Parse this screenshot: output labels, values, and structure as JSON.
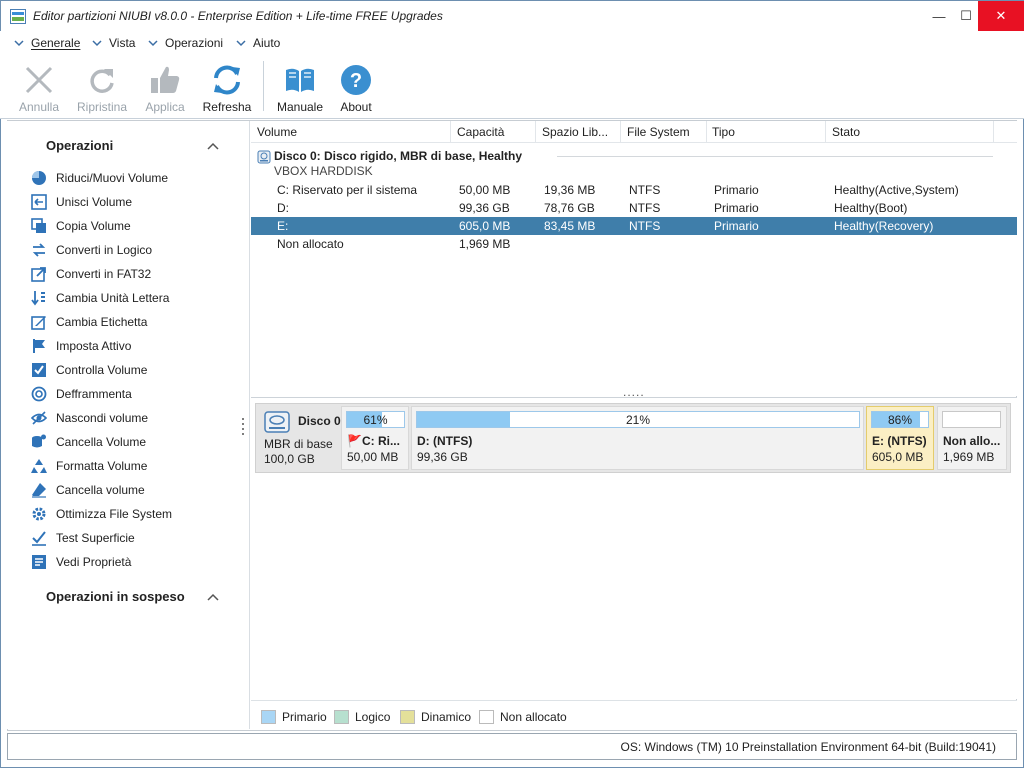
{
  "window": {
    "title": "Editor partizioni NIUBI v8.0.0 - Enterprise Edition + Life-time FREE Upgrades",
    "minimize_glyph": "—",
    "maximize_glyph": "☐",
    "close_glyph": "✕"
  },
  "menu": {
    "items": [
      {
        "label": "Generale"
      },
      {
        "label": "Vista"
      },
      {
        "label": "Operazioni"
      },
      {
        "label": "Aiuto"
      }
    ]
  },
  "toolbar": {
    "buttons": [
      {
        "label": "Annulla",
        "icon": "close-icon",
        "enabled": false
      },
      {
        "label": "Ripristina",
        "icon": "redo-icon",
        "enabled": false
      },
      {
        "label": "Applica",
        "icon": "thumbs-up-icon",
        "enabled": false
      },
      {
        "label": "Refresha",
        "icon": "refresh-icon",
        "enabled": true
      },
      {
        "label": "Manuale",
        "icon": "book-icon",
        "enabled": true
      },
      {
        "label": "About",
        "icon": "help-icon",
        "enabled": true
      }
    ]
  },
  "sidebar": {
    "operations_title": "Operazioni",
    "pending_title": "Operazioni in sospeso",
    "items": [
      {
        "label": "Riduci/Muovi Volume",
        "icon": "resize-icon"
      },
      {
        "label": "Unisci Volume",
        "icon": "merge-icon"
      },
      {
        "label": "Copia Volume",
        "icon": "copy-icon"
      },
      {
        "label": "Converti in Logico",
        "icon": "convert-icon"
      },
      {
        "label": "Converti in FAT32",
        "icon": "convert-fat32-icon"
      },
      {
        "label": "Cambia Unità Lettera",
        "icon": "drive-letter-icon"
      },
      {
        "label": "Cambia Etichetta",
        "icon": "edit-label-icon"
      },
      {
        "label": "Imposta Attivo",
        "icon": "flag-icon"
      },
      {
        "label": "Controlla Volume",
        "icon": "check-icon"
      },
      {
        "label": "Defframmenta",
        "icon": "defrag-icon"
      },
      {
        "label": "Nascondi volume",
        "icon": "hide-icon"
      },
      {
        "label": "Cancella Volume",
        "icon": "delete-volume-icon"
      },
      {
        "label": "Formatta Volume",
        "icon": "format-icon"
      },
      {
        "label": "Cancella volume",
        "icon": "eraser-icon"
      },
      {
        "label": "Ottimizza File System",
        "icon": "optimize-icon"
      },
      {
        "label": "Test Superficie",
        "icon": "surface-test-icon"
      },
      {
        "label": "Vedi Proprietà",
        "icon": "properties-icon"
      }
    ]
  },
  "table": {
    "columns": [
      "Volume",
      "Capacità",
      "Spazio Lib...",
      "File System",
      "Tipo",
      "Stato"
    ],
    "disk": {
      "title": "Disco 0: Disco rigido, MBR di base, Healthy",
      "subtitle": "VBOX HARDDISK"
    },
    "rows": [
      {
        "volume": "C: Riservato per il sistema",
        "capacity": "50,00 MB",
        "free": "19,36 MB",
        "fs": "NTFS",
        "type": "Primario",
        "status": "Healthy(Active,System)",
        "selected": false
      },
      {
        "volume": "D:",
        "capacity": "99,36 GB",
        "free": "78,76 GB",
        "fs": "NTFS",
        "type": "Primario",
        "status": "Healthy(Boot)",
        "selected": false
      },
      {
        "volume": "E:",
        "capacity": "605,0 MB",
        "free": "83,45 MB",
        "fs": "NTFS",
        "type": "Primario",
        "status": "Healthy(Recovery)",
        "selected": true
      },
      {
        "volume": "Non allocato",
        "capacity": "1,969 MB",
        "free": "",
        "fs": "",
        "type": "",
        "status": "",
        "selected": false
      }
    ],
    "splitter_text": "....."
  },
  "diskmap": {
    "disk_name": "Disco 0",
    "disk_type": "MBR di base",
    "disk_size": "100,0 GB",
    "partitions": [
      {
        "pct_label": "61%",
        "used_fraction": 0.61,
        "label": "C: Ri...",
        "flag": "🚩",
        "size": "50,00 MB",
        "selected": false
      },
      {
        "pct_label": "21%",
        "used_fraction": 0.21,
        "label": "D: (NTFS)",
        "flag": "",
        "size": "99,36 GB",
        "selected": false
      },
      {
        "pct_label": "86%",
        "used_fraction": 0.86,
        "label": "E: (NTFS)",
        "flag": "",
        "size": "605,0 MB",
        "selected": true
      },
      {
        "pct_label": "",
        "used_fraction": 0,
        "label": "Non allo...",
        "flag": "",
        "size": "1,969 MB",
        "selected": false
      }
    ]
  },
  "legend": {
    "items": [
      {
        "label": "Primario",
        "color": "#a9d6f5"
      },
      {
        "label": "Logico",
        "color": "#b7e0cf"
      },
      {
        "label": "Dinamico",
        "color": "#e4e09a"
      },
      {
        "label": "Non allocato",
        "color": "#ffffff"
      }
    ]
  },
  "status": {
    "text": "OS: Windows (TM) 10 Preinstallation Environment 64-bit (Build:19041)"
  },
  "colors": {
    "selection": "#3f7eaa",
    "icon_blue": "#2f73b8",
    "disabled": "#9aa3ab",
    "close_red": "#e81123"
  }
}
